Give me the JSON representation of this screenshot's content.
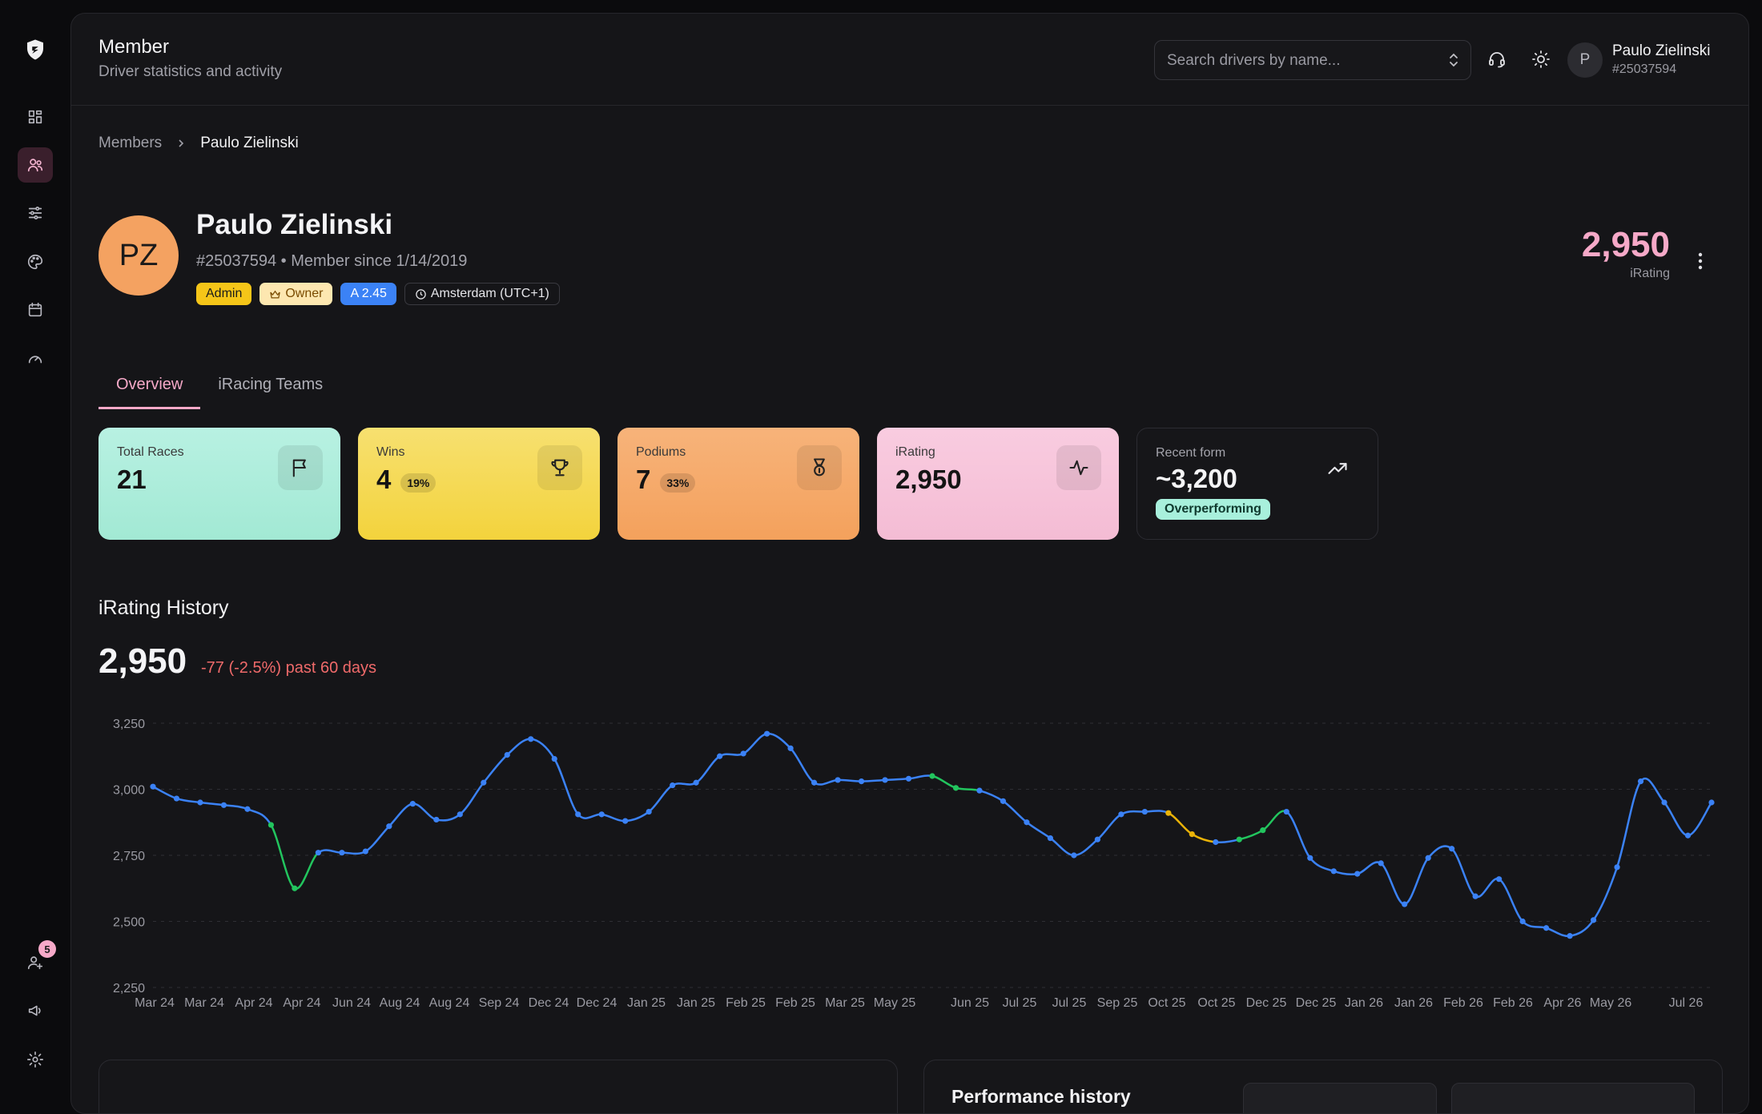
{
  "sidebar": {
    "items": [
      {
        "name": "dashboard",
        "active": false
      },
      {
        "name": "members",
        "active": true
      },
      {
        "name": "settings-sliders",
        "active": false
      },
      {
        "name": "palette",
        "active": false
      },
      {
        "name": "calendar",
        "active": false
      },
      {
        "name": "gauge",
        "active": false
      }
    ],
    "invites_badge": "5"
  },
  "header": {
    "title": "Member",
    "subtitle": "Driver statistics and activity",
    "search_placeholder": "Search drivers by name...",
    "user_initial": "P",
    "user_name": "Paulo Zielinski",
    "user_id": "#25037594"
  },
  "breadcrumb": {
    "root": "Members",
    "current": "Paulo Zielinski"
  },
  "profile": {
    "initials": "PZ",
    "name": "Paulo Zielinski",
    "meta": "#25037594 • Member since 1/14/2019",
    "tags": {
      "admin": "Admin",
      "owner": "Owner",
      "license": "A 2.45",
      "timezone": "Amsterdam (UTC+1)"
    },
    "irating": "2,950",
    "irating_label": "iRating"
  },
  "tabs": [
    {
      "label": "Overview",
      "active": true
    },
    {
      "label": "iRacing Teams",
      "active": false
    }
  ],
  "stats": {
    "total_races": {
      "label": "Total Races",
      "value": "21"
    },
    "wins": {
      "label": "Wins",
      "value": "4",
      "pct": "19%"
    },
    "podiums": {
      "label": "Podiums",
      "value": "7",
      "pct": "33%"
    },
    "irating": {
      "label": "iRating",
      "value": "2,950"
    },
    "recent_form": {
      "label": "Recent form",
      "value": "~3,200",
      "badge": "Overperforming"
    }
  },
  "history": {
    "title": "iRating History",
    "value": "2,950",
    "delta": "-77 (-2.5%) past 60 days"
  },
  "chart_data": {
    "type": "line",
    "ylim": [
      2250,
      3250
    ],
    "yticks": [
      "3,250",
      "3,000",
      "2,750",
      "2,500",
      "2,250"
    ],
    "x_tick_labels": [
      "Mar 24",
      "Mar 24",
      "Apr 24",
      "Apr 24",
      "Jun 24",
      "Aug 24",
      "Aug 24",
      "Sep 24",
      "Dec 24",
      "Dec 24",
      "Jan 25",
      "Jan 25",
      "Feb 25",
      "Feb 25",
      "Mar 25",
      "May 25",
      "Jun 25",
      "Jul 25",
      "Jul 25",
      "Sep 25",
      "Oct 25",
      "Oct 25",
      "Dec 25",
      "Dec 25",
      "Jan 26",
      "Jan 26",
      "Feb 26",
      "Feb 26",
      "Apr 26",
      "May 26",
      "Jul 26"
    ],
    "values": [
      3010,
      2965,
      2950,
      2940,
      2925,
      2865,
      2625,
      2760,
      2760,
      2765,
      2860,
      2945,
      2885,
      2905,
      3025,
      3130,
      3190,
      3115,
      2905,
      2905,
      2880,
      2915,
      3015,
      3025,
      3125,
      3135,
      3210,
      3155,
      3025,
      3035,
      3030,
      3035,
      3040,
      3050,
      3005,
      2995,
      2955,
      2875,
      2815,
      2750,
      2810,
      2905,
      2915,
      2910,
      2830,
      2800,
      2810,
      2845,
      2915,
      2740,
      2690,
      2680,
      2720,
      2565,
      2740,
      2775,
      2595,
      2660,
      2500,
      2475,
      2445,
      2505,
      2705,
      3030,
      2950,
      2825,
      2950
    ],
    "segment_colors": {
      "default": "#3b82f6",
      "improving": "#22c55e",
      "neutral": "#eab308"
    }
  },
  "bottom": {
    "performance_title": "Performance history"
  }
}
